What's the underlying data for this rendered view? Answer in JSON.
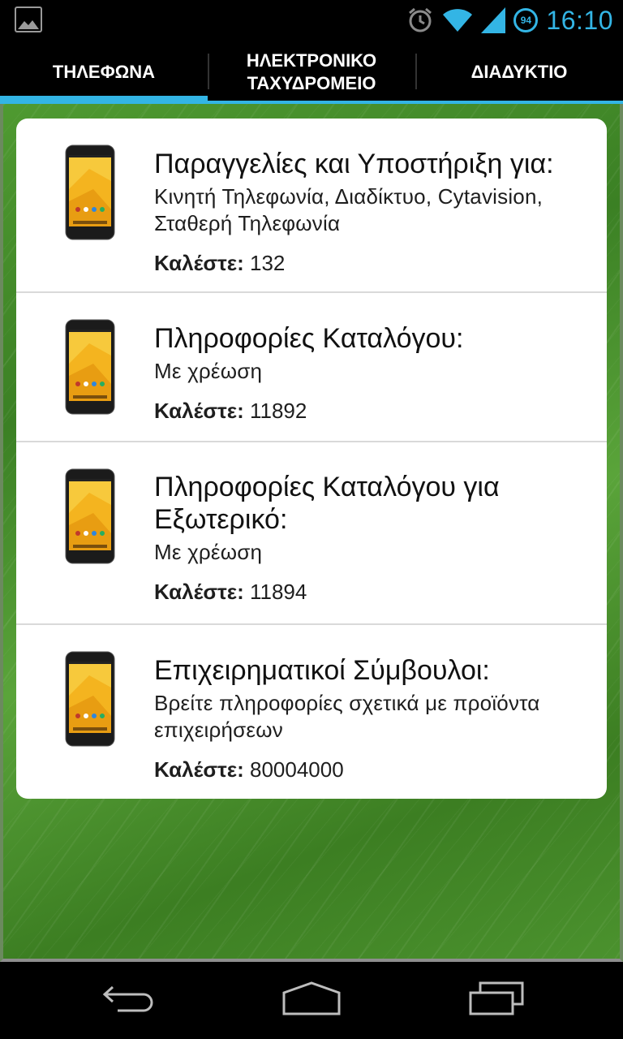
{
  "status_bar": {
    "time": "16:10",
    "battery_level": "94",
    "left_icon": "picture-icon",
    "icons": [
      "alarm-clock-icon",
      "wifi-icon",
      "signal-icon",
      "battery-icon"
    ],
    "accent_color": "#33b5e5"
  },
  "tabs": [
    {
      "label": "ΤΗΛΕΦΩΝΑ",
      "active": true
    },
    {
      "label": "ΗΛΕΚΤΡΟΝΙΚΟ\nΤΑΧΥΔΡΟΜΕΙΟ",
      "active": false
    },
    {
      "label": "ΔΙΑΔΥΚΤΙΟ",
      "active": false
    }
  ],
  "contacts": [
    {
      "icon": "phone-icon",
      "title": "Παραγγελίες και Υποστήριξη για:",
      "description": "Κινητή Τηλεφωνία, Διαδίκτυο, Cytavision, Σταθερή Τηλεφωνία",
      "call_label": "Καλέστε:",
      "number": "132"
    },
    {
      "icon": "phone-icon",
      "title": "Πληροφορίες Καταλόγου:",
      "description": "Με χρέωση",
      "call_label": "Καλέστε:",
      "number": "11892"
    },
    {
      "icon": "phone-icon",
      "title": "Πληροφορίες Καταλόγου για Εξωτερικό:",
      "description": "Με χρέωση",
      "call_label": "Καλέστε:",
      "number": "11894"
    },
    {
      "icon": "phone-icon",
      "title": "Επιχειρηματικοί Σύμβουλοι:",
      "description": "Βρείτε πληροφορίες σχετικά με προϊόντα επιχειρήσεων",
      "call_label": "Καλέστε:",
      "number": "80004000"
    }
  ],
  "nav_bar": {
    "icons": [
      "back-icon",
      "home-icon",
      "recent-apps-icon"
    ]
  }
}
